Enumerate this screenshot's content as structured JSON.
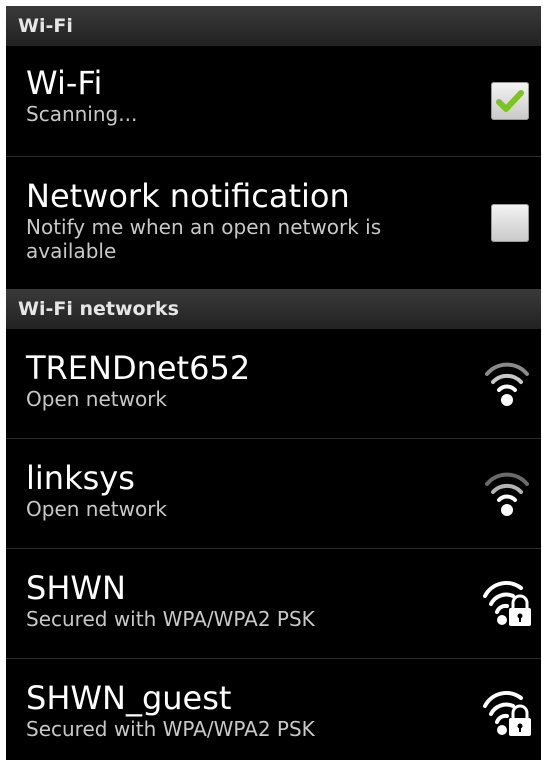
{
  "header": {
    "label": "Wi-Fi"
  },
  "wifi_toggle": {
    "title": "Wi-Fi",
    "summary": "Scanning...",
    "checked": true
  },
  "network_notification": {
    "title": "Network notification",
    "summary": "Notify me when an open network is available",
    "checked": false
  },
  "networks_header": {
    "label": "Wi-Fi networks"
  },
  "networks": [
    {
      "ssid": "TRENDnet652",
      "security": "Open network",
      "secured": false,
      "icon": "wifi-signal-icon"
    },
    {
      "ssid": "linksys",
      "security": "Open network",
      "secured": false,
      "icon": "wifi-signal-icon"
    },
    {
      "ssid": "SHWN",
      "security": "Secured with WPA/WPA2 PSK",
      "secured": true,
      "icon": "wifi-signal-lock-icon"
    },
    {
      "ssid": "SHWN_guest",
      "security": "Secured with WPA/WPA2 PSK",
      "secured": true,
      "icon": "wifi-signal-lock-icon"
    }
  ],
  "colors": {
    "background": "#000000",
    "check_green": "#7bc61e"
  }
}
